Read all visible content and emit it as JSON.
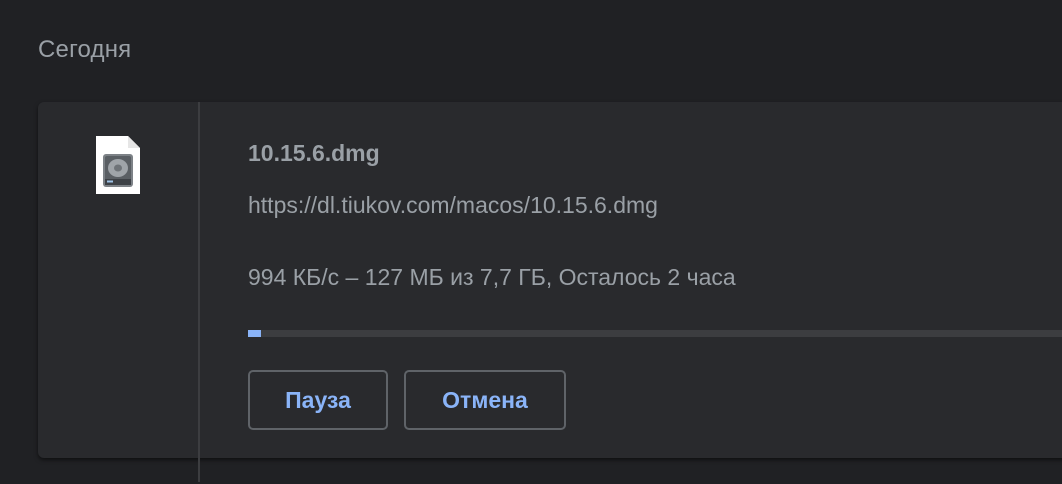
{
  "section": {
    "title": "Сегодня"
  },
  "download": {
    "icon": "disk-image-file-icon",
    "filename": "10.15.6.dmg",
    "url": "https://dl.tiukov.com/macos/10.15.6.dmg",
    "status": "994 КБ/с – 127 МБ из 7,7 ГБ, Осталось 2 часа",
    "progress_fraction": 0.016,
    "pause_label": "Пауза",
    "cancel_label": "Отмена"
  },
  "colors": {
    "background": "#202124",
    "card": "#292a2d",
    "text": "#9aa0a6",
    "accent": "#8ab4f8",
    "track": "#3c3d40",
    "button_border": "#5f6368"
  }
}
